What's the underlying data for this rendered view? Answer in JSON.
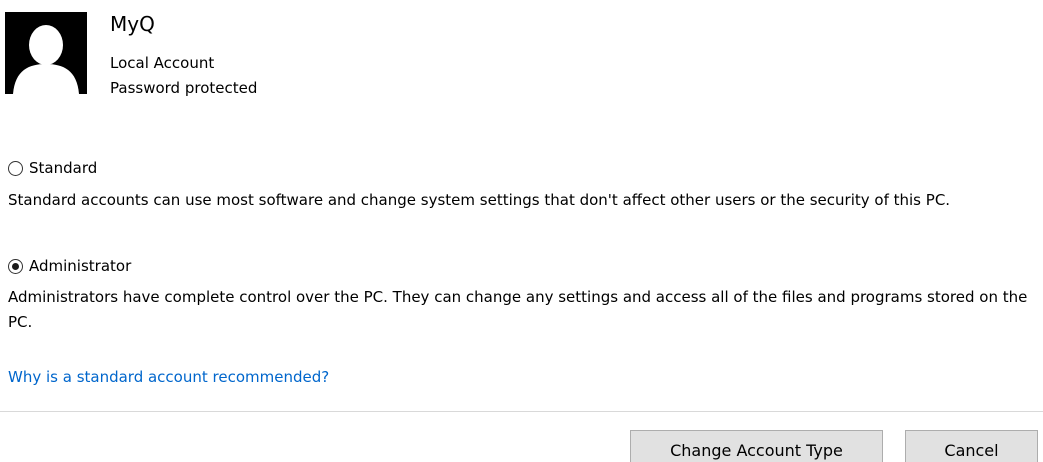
{
  "account": {
    "name": "MyQ",
    "type": "Local Account",
    "protection": "Password protected",
    "avatar_icon": "user-silhouette-icon"
  },
  "options": {
    "standard": {
      "label": "Standard",
      "description": "Standard accounts can use most software and change system settings that don't affect other users or the security of this PC.",
      "selected": false
    },
    "administrator": {
      "label": "Administrator",
      "description": "Administrators have complete control over the PC. They can change any settings and access all of the files and programs stored on the PC.",
      "selected": true
    }
  },
  "help_link": "Why is a standard account recommended?",
  "buttons": {
    "change": "Change Account Type",
    "cancel": "Cancel"
  },
  "colors": {
    "link": "#0066cc",
    "button_bg": "#e1e1e1",
    "button_border": "#adadad",
    "divider": "#d9d9d9"
  }
}
